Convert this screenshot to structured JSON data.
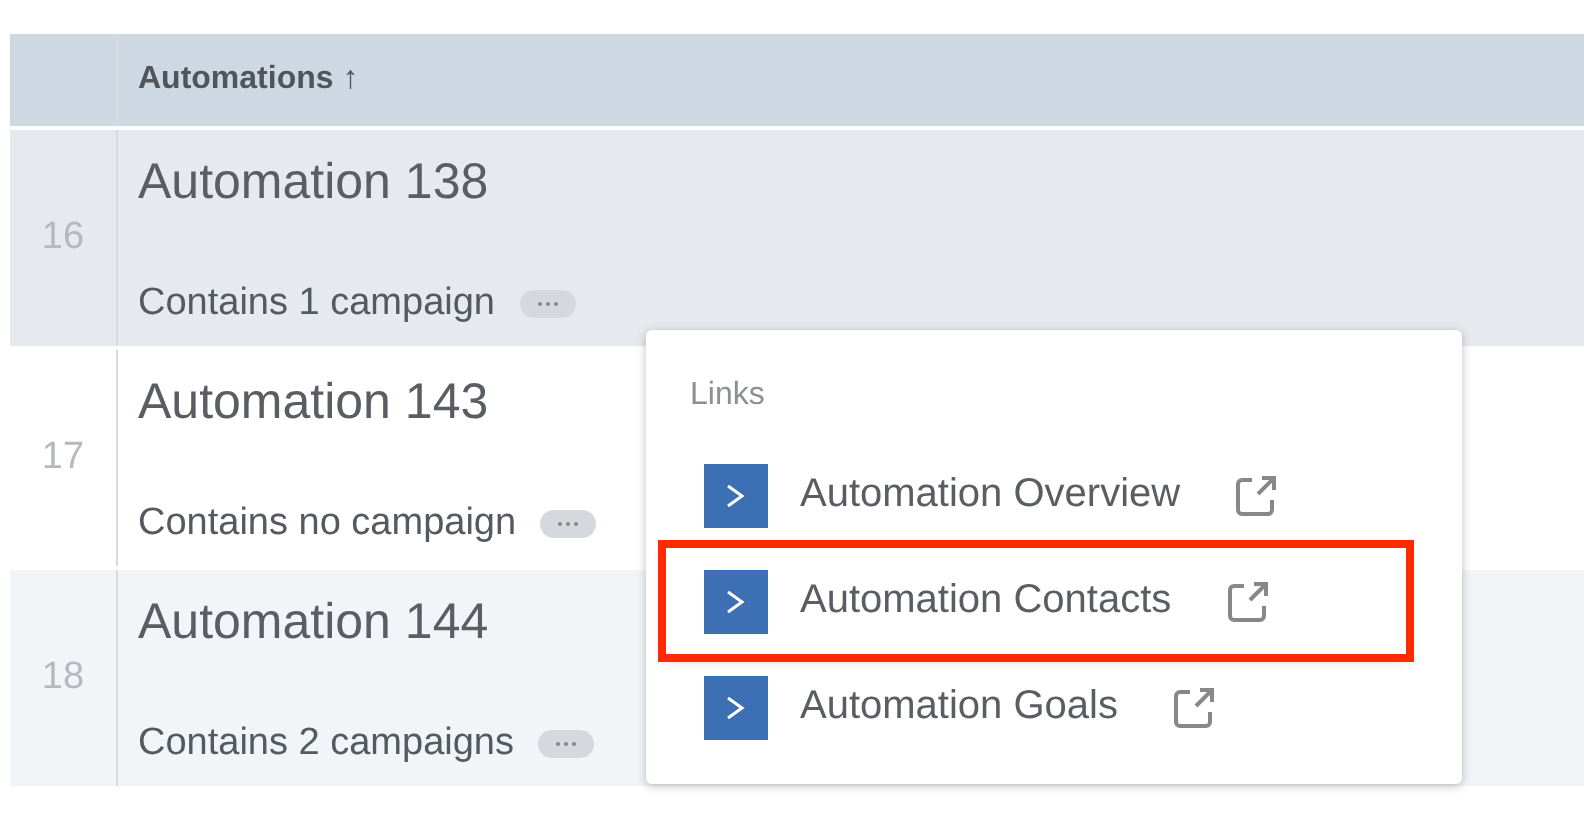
{
  "table": {
    "columns": [
      {
        "label": "Automations ↑"
      }
    ],
    "rows": [
      {
        "number": "16",
        "title": "Automation 138",
        "summary": "Contains 1 campaign",
        "selected": true
      },
      {
        "number": "17",
        "title": "Automation 143",
        "summary": "Contains no campaign",
        "selected": false
      },
      {
        "number": "18",
        "title": "Automation 144",
        "summary": "Contains 2 campaigns",
        "selected": false
      }
    ]
  },
  "popup": {
    "heading": "Links",
    "items": [
      {
        "label": "Automation Overview",
        "highlighted": false
      },
      {
        "label": "Automation Contacts",
        "highlighted": true
      },
      {
        "label": "Automation Goals",
        "highlighted": false
      }
    ]
  }
}
